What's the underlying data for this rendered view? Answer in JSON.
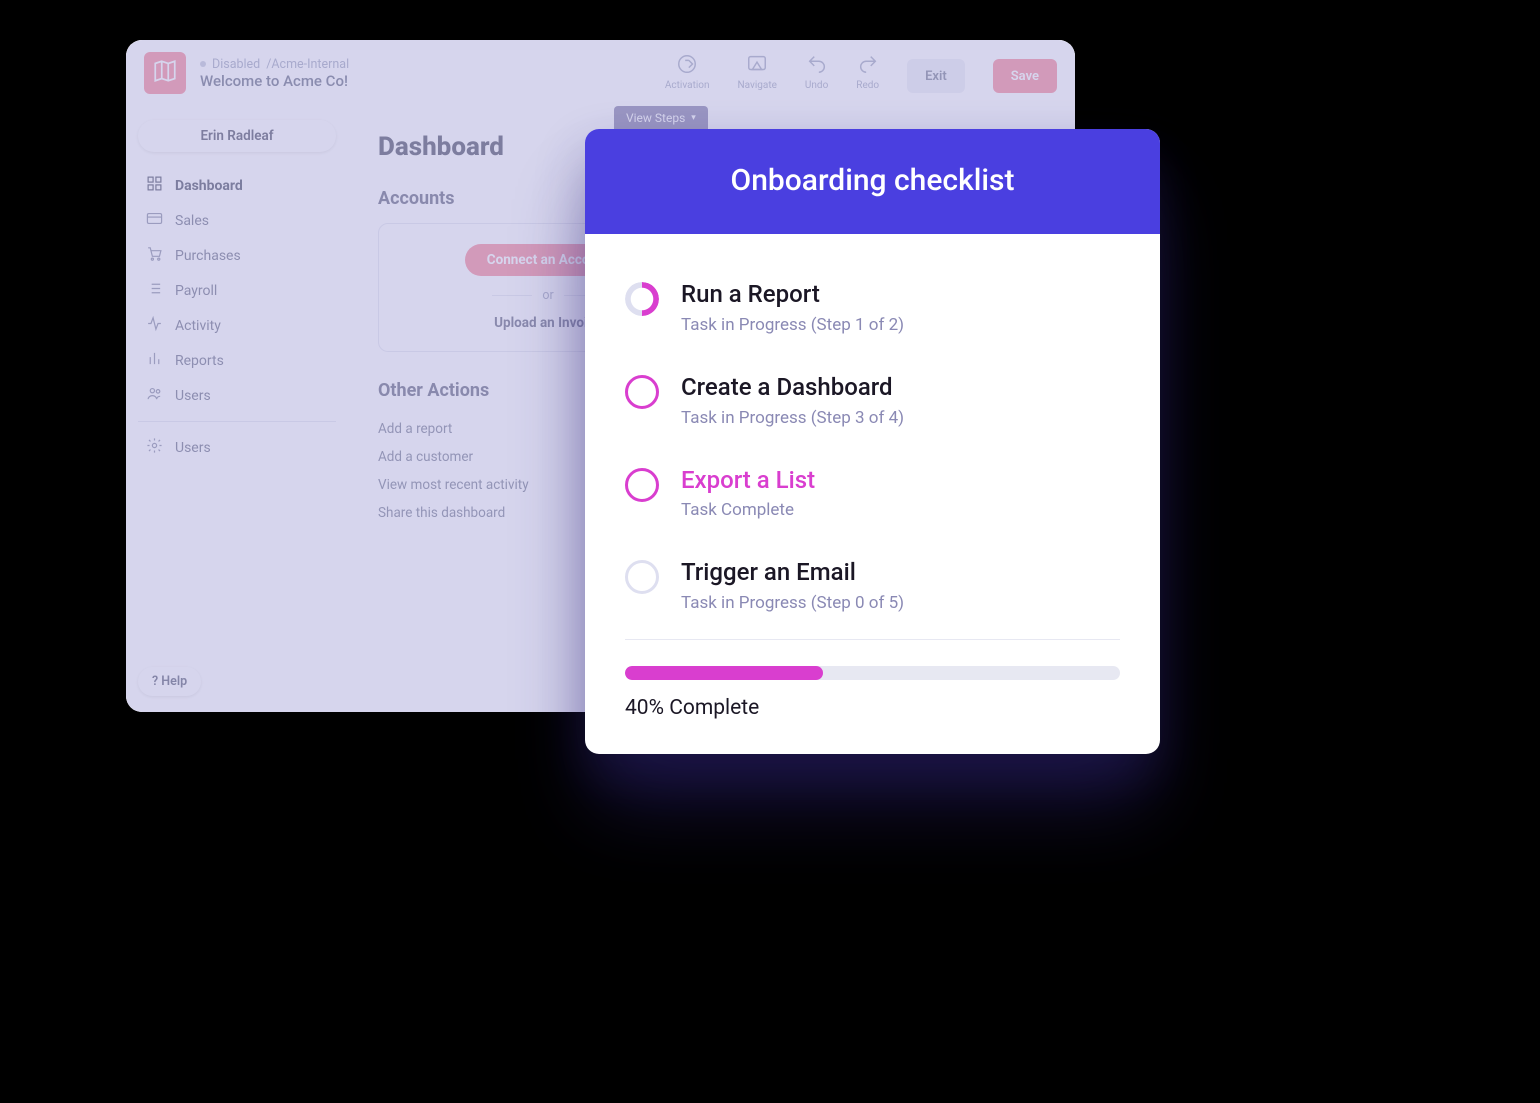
{
  "editor": {
    "status": "Disabled",
    "crumb_path": "/Acme-Internal",
    "title": "Welcome to Acme Co!",
    "tools": {
      "activation": "Activation",
      "navigate": "Navigate",
      "undo": "Undo",
      "redo": "Redo"
    },
    "exit_label": "Exit",
    "save_label": "Save",
    "view_steps_label": "View Steps"
  },
  "sidebar": {
    "user_name": "Erin Radleaf",
    "items": [
      {
        "label": "Dashboard"
      },
      {
        "label": "Sales"
      },
      {
        "label": "Purchases"
      },
      {
        "label": "Payroll"
      },
      {
        "label": "Activity"
      },
      {
        "label": "Reports"
      },
      {
        "label": "Users"
      }
    ],
    "settings_label": "Users",
    "help_label": "? Help"
  },
  "dashboard": {
    "heading": "Dashboard",
    "accounts_title": "Accounts",
    "connect_label": "Connect an Account",
    "or_label": "or",
    "upload_label": "Upload an Invoice",
    "other_title": "Other Actions",
    "links": [
      "Add a report",
      "Add a customer",
      "View most recent activity",
      "Share this dashboard"
    ]
  },
  "checklist": {
    "title": "Onboarding checklist",
    "tasks": [
      {
        "title": "Run a Report",
        "sub": "Task in Progress (Step 1 of 2)",
        "state": "partial"
      },
      {
        "title": "Create a Dashboard",
        "sub": "Task in Progress (Step 3 of 4)",
        "state": "ring"
      },
      {
        "title": "Export a List",
        "sub": "Task Complete",
        "state": "ring-hot"
      },
      {
        "title": "Trigger an Email",
        "sub": "Task in Progress (Step 0 of 5)",
        "state": "grey"
      }
    ],
    "progress_percent": 40,
    "progress_label": "40% Complete"
  }
}
